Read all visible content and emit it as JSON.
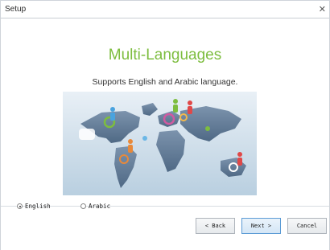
{
  "window": {
    "title": "Setup",
    "close_glyph": "✕"
  },
  "main": {
    "heading": "Multi-Languages",
    "subtitle": "Supports English and Arabic language."
  },
  "language_options": [
    {
      "label": "English",
      "selected": true
    },
    {
      "label": "Arabic",
      "selected": false
    }
  ],
  "buttons": {
    "back": "< Back",
    "next": "Next >",
    "cancel": "Cancel"
  },
  "colors": {
    "heading": "#7dbd3f",
    "accent": "#5b9bd5"
  }
}
